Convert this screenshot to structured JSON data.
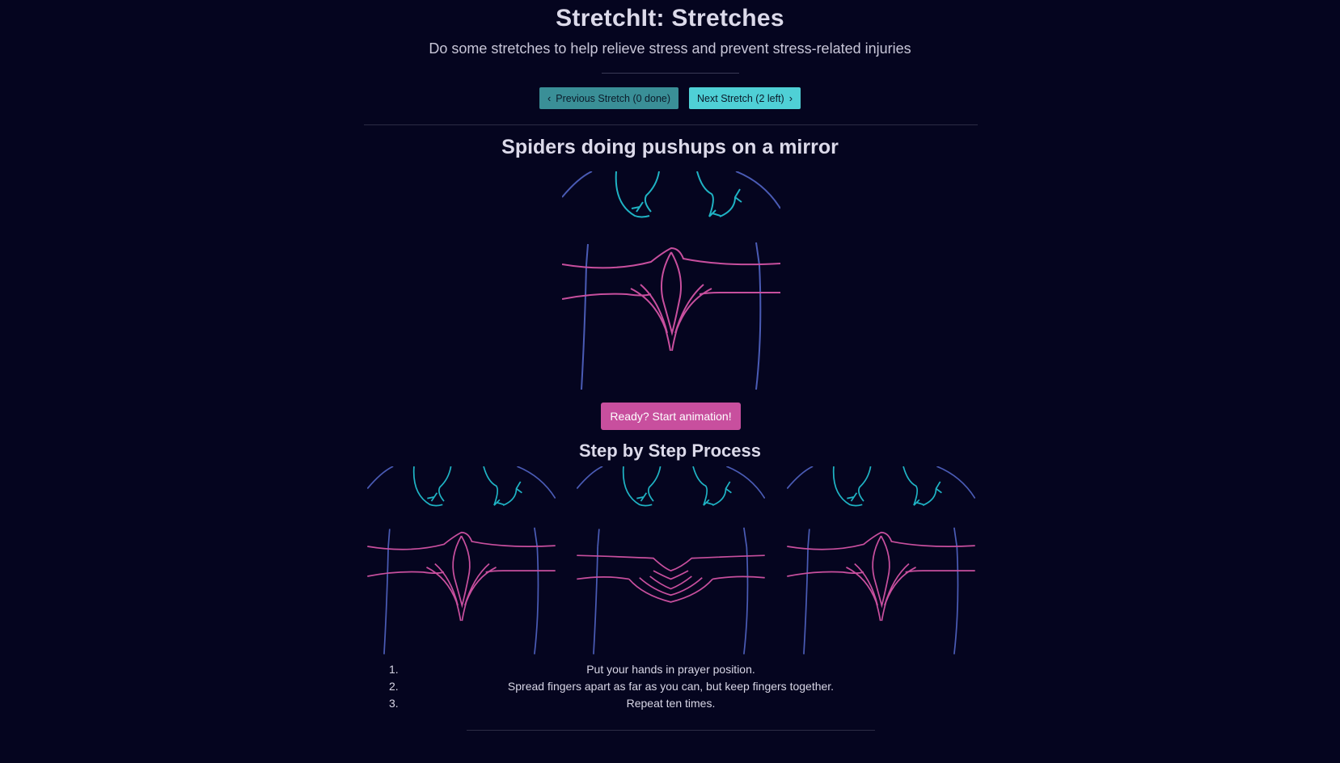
{
  "header": {
    "title": "StretchIt: Stretches",
    "subtitle": "Do some stretches to help relieve stress and prevent stress-related injuries"
  },
  "nav": {
    "prev_label": "Previous Stretch (0 done)",
    "next_label": "Next Stretch (2 left)"
  },
  "stretch": {
    "name": "Spiders doing pushups on a mirror",
    "start_label": "Ready? Start animation!",
    "steps_heading": "Step by Step Process",
    "steps": [
      {
        "num": "1.",
        "text": "Put your hands in prayer position."
      },
      {
        "num": "2.",
        "text": "Spread fingers apart as far as you can, but keep fingers together."
      },
      {
        "num": "3.",
        "text": "Repeat ten times."
      }
    ]
  },
  "colors": {
    "background": "#05051f",
    "arm_outline": "#4a5bb5",
    "hand_top": "#1fb3c4",
    "hand_bottom": "#c84f9e",
    "prev_button": "#3a8f97",
    "next_button": "#4fd0d6",
    "start_button": "#c84f9e"
  },
  "icons": {
    "prev": "chevron-left-icon",
    "next": "chevron-right-icon"
  }
}
